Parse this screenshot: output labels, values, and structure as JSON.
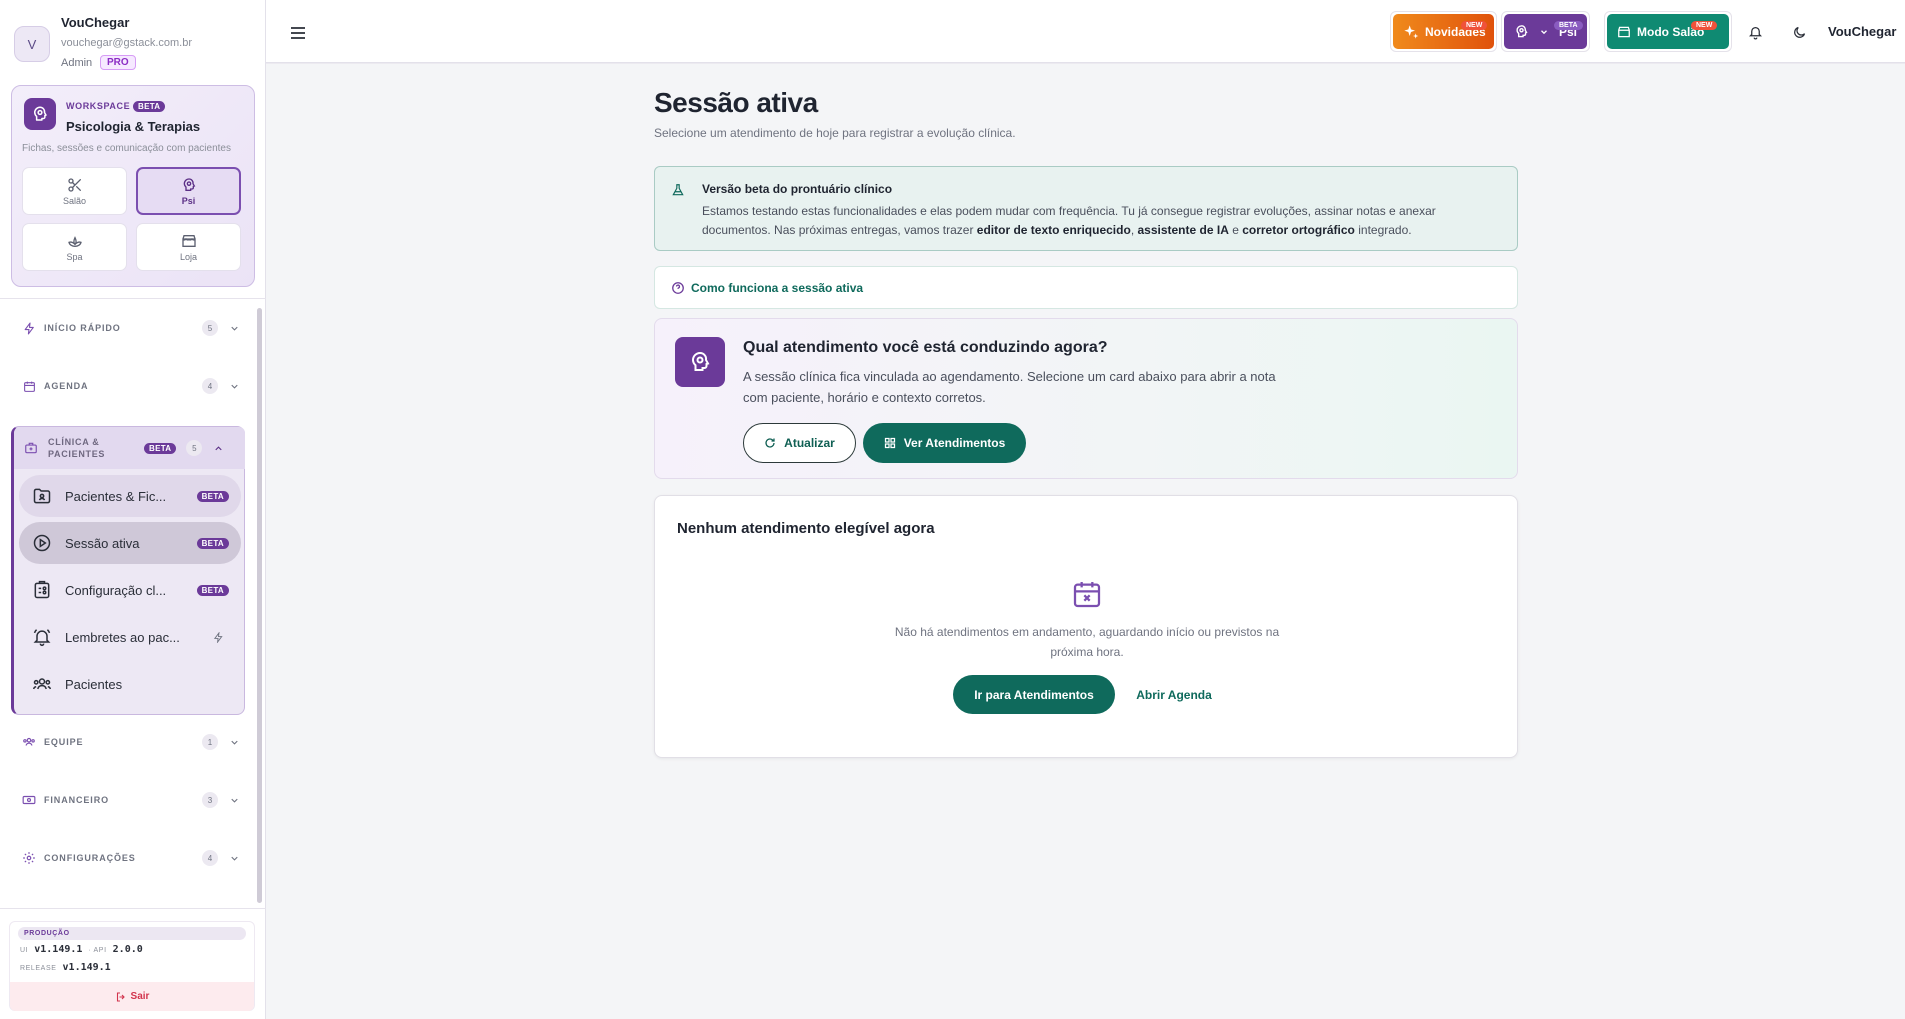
{
  "user": {
    "initial": "V",
    "name": "VouChegar",
    "email": "vouchegar@gstack.com.br",
    "role": "Admin",
    "plan": "PRO"
  },
  "workspace": {
    "label": "WORKSPACE",
    "badge": "BETA",
    "name": "Psicologia & Terapias",
    "description": "Fichas, sessões e comunicação com pacientes",
    "tiles": [
      {
        "label": "Salão",
        "icon": "scissors-icon"
      },
      {
        "label": "Psi",
        "icon": "brain-icon",
        "active": true
      },
      {
        "label": "Spa",
        "icon": "lotus-icon"
      },
      {
        "label": "Loja",
        "icon": "store-icon"
      }
    ]
  },
  "nav": {
    "quick": {
      "label": "INÍCIO RÁPIDO",
      "count": "5"
    },
    "agenda": {
      "label": "AGENDA",
      "count": "4"
    },
    "clinic": {
      "label": "CLÍNICA & PACIENTES",
      "badge": "BETA",
      "count": "5",
      "items": [
        {
          "label": "Pacientes & Fic...",
          "badge": "BETA"
        },
        {
          "label": "Sessão ativa",
          "badge": "BETA"
        },
        {
          "label": "Configuração cl...",
          "badge": "BETA"
        },
        {
          "label": "Lembretes ao pac..."
        },
        {
          "label": "Pacientes"
        }
      ]
    },
    "team": {
      "label": "EQUIPE",
      "count": "1"
    },
    "finance": {
      "label": "FINANCEIRO",
      "count": "3"
    },
    "settings": {
      "label": "CONFIGURAÇÕES",
      "count": "4"
    }
  },
  "footer": {
    "env": "PRODUÇÃO",
    "ui_key": "UI",
    "ui_version": "v1.149.1",
    "api_key": "API",
    "api_version": "2.0.0",
    "release_key": "RELEASE",
    "release_version": "v1.149.1",
    "logout": "Sair"
  },
  "topbar": {
    "news_label": "Novidades",
    "new_tag": "NEW",
    "psi_label": "Psi",
    "beta_tag": "BETA",
    "salon_label": "Modo Salão",
    "user_name": "VouChegar"
  },
  "page": {
    "title": "Sessão ativa",
    "subtitle": "Selecione um atendimento de hoje para registrar a evolução clínica."
  },
  "beta_notice": {
    "title": "Versão beta do prontuário clínico",
    "text_1": "Estamos testando estas funcionalidades e elas podem mudar com frequência. Tu já consegue registrar evoluções, assinar notas e anexar documentos. Nas próximas entregas, vamos trazer ",
    "bold_1": "editor de texto enriquecido",
    "sep_1": ", ",
    "bold_2": "assistente de IA",
    "sep_2": " e ",
    "bold_3": "corretor ortográfico",
    "text_2": " integrado."
  },
  "how_it_works": "Como funciona a sessão ativa",
  "conduct": {
    "title": "Qual atendimento você está conduzindo agora?",
    "body": "A sessão clínica fica vinculada ao agendamento. Selecione um card abaixo para abrir a nota com paciente, horário e contexto corretos.",
    "refresh": "Atualizar",
    "view": "Ver Atendimentos"
  },
  "empty": {
    "title": "Nenhum atendimento elegível agora",
    "message": "Não há atendimentos em andamento, aguardando início ou previstos na próxima hora.",
    "go": "Ir para Atendimentos",
    "agenda": "Abrir Agenda"
  },
  "colors": {
    "brand_purple": "#6b3a99",
    "brand_teal": "#0f6a5c",
    "news_orange": "#e8620f",
    "new_red": "#f0523a"
  }
}
